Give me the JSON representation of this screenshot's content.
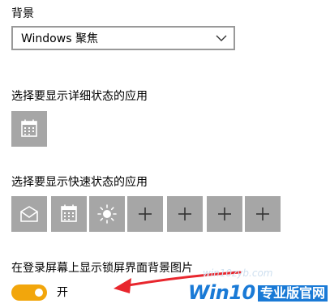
{
  "background_section": {
    "title": "背景",
    "dropdown_value": "Windows 聚焦"
  },
  "detailed_status": {
    "title": "选择要显示详细状态的应用",
    "tiles": [
      {
        "icon": "calendar-icon"
      }
    ]
  },
  "quick_status": {
    "title": "选择要显示快速状态的应用",
    "tiles": [
      {
        "icon": "mail-icon"
      },
      {
        "icon": "calendar-icon"
      },
      {
        "icon": "weather-sun-icon"
      },
      {
        "icon": "plus-icon"
      },
      {
        "icon": "plus-icon"
      },
      {
        "icon": "plus-icon"
      },
      {
        "icon": "plus-icon"
      }
    ]
  },
  "signin_background": {
    "title": "在登录屏幕上显示锁屏界面背景图片",
    "toggle_state": "on",
    "toggle_label": "开"
  },
  "watermark": {
    "url_text": "win10zyb.com",
    "brand_text": "Win10",
    "brand_cn": "专业版官网"
  },
  "colors": {
    "tile_bg": "#a6a6a6",
    "toggle_on": "#f2a60c",
    "arrow": "#e8262d",
    "brand_blue": "#1a7ad6"
  }
}
